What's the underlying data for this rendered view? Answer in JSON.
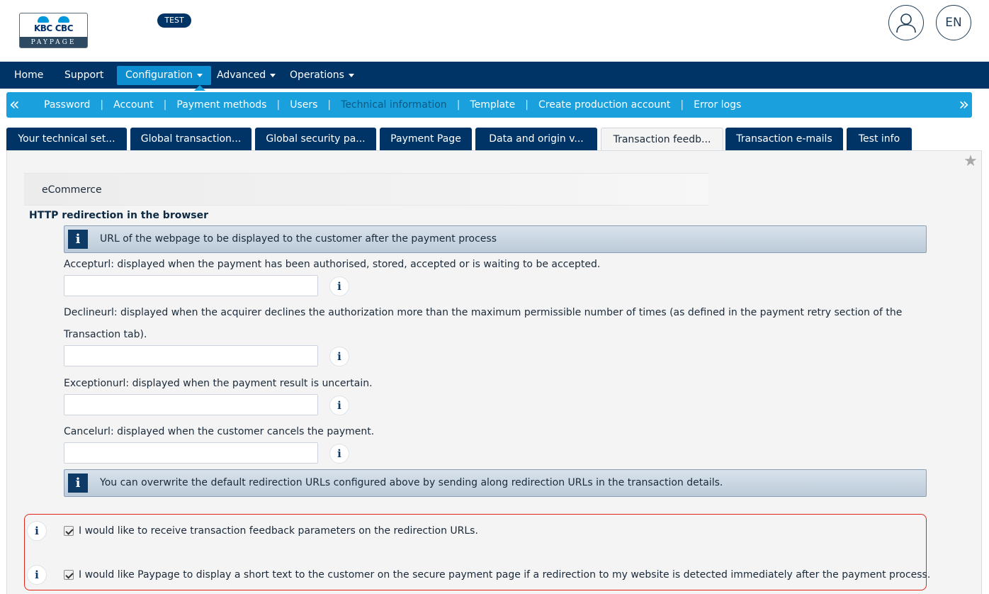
{
  "header": {
    "logo_brand_left": "KBC",
    "logo_brand_right": "CBC",
    "logo_subtitle": "PAYPAGE",
    "env_badge": "TEST",
    "language": "EN"
  },
  "main_nav": {
    "items": [
      {
        "label": "Home"
      },
      {
        "label": "Support"
      },
      {
        "label": "Configuration"
      },
      {
        "label": "Advanced"
      },
      {
        "label": "Operations"
      }
    ]
  },
  "sub_nav": {
    "items": [
      {
        "label": "Password"
      },
      {
        "label": "Account"
      },
      {
        "label": "Payment methods"
      },
      {
        "label": "Users"
      },
      {
        "label": "Technical information"
      },
      {
        "label": "Template"
      },
      {
        "label": "Create production account"
      },
      {
        "label": "Error logs"
      }
    ]
  },
  "tabs": [
    {
      "label": "Your technical set..."
    },
    {
      "label": "Global transaction..."
    },
    {
      "label": "Global security pa..."
    },
    {
      "label": "Payment Page"
    },
    {
      "label": "Data and origin v..."
    },
    {
      "label": "Transaction feedb..."
    },
    {
      "label": "Transaction e-mails"
    },
    {
      "label": "Test info"
    }
  ],
  "content": {
    "section_title": "eCommerce",
    "group_title": "HTTP redirection in the browser",
    "info_url": "URL of the webpage to be displayed to the customer after the payment process",
    "fields": [
      {
        "label": "Accepturl: displayed when the payment has been authorised, stored, accepted or is waiting to be accepted.",
        "value": ""
      },
      {
        "label": "Declineurl: displayed when the acquirer declines the authorization more than the maximum permissible number of times (as defined in the payment retry section of the",
        "label_line2": "Transaction tab).",
        "value": ""
      },
      {
        "label": "Exceptionurl: displayed when the payment result is uncertain.",
        "value": ""
      },
      {
        "label": "Cancelurl: displayed when the customer cancels the payment.",
        "value": ""
      }
    ],
    "info_overwrite": "You can overwrite the default redirection URLs configured above by sending along redirection URLs in the transaction details.",
    "checkboxes": [
      {
        "label": "I would like to receive transaction feedback parameters on the redirection URLs.",
        "checked": true
      },
      {
        "label": "I would like Paypage to display a short text to the customer on the secure payment page if a redirection to my website is detected immediately after the payment process.",
        "checked": true
      }
    ],
    "info_glyph": "i"
  }
}
